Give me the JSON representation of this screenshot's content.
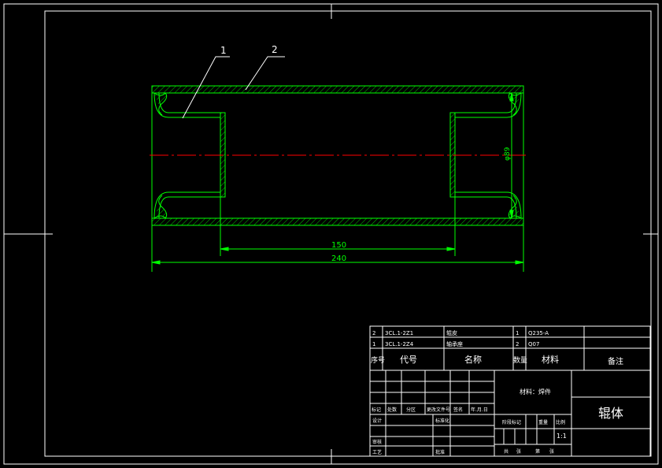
{
  "callouts": [
    "1",
    "2"
  ],
  "dimensions": {
    "inner": "150",
    "overall": "240",
    "diameter": "φ89"
  },
  "bom": {
    "rows": [
      {
        "no": "2",
        "code": "3CL.1-2Z1",
        "name": "辊皮",
        "qty": "1",
        "material": "Q235-A"
      },
      {
        "no": "1",
        "code": "3CL.1-2Z4",
        "name": "轴承座",
        "qty": "2",
        "material": "Q07"
      }
    ],
    "header": {
      "no": "序号",
      "code": "代号",
      "name": "名称",
      "qty": "数量",
      "material": "材料",
      "remark": "备注"
    }
  },
  "titleblock": {
    "material_note": "材料：焊件",
    "part_name": "辊体",
    "scale": "1:1",
    "grid_labels": {
      "mark": "标记",
      "count": "处数",
      "zone": "分区",
      "docno": "更改文件号",
      "sign": "签名",
      "date": "年.月.日",
      "design": "设计",
      "standard": "标准化",
      "review": "审核",
      "process": "工艺",
      "approve": "批准"
    },
    "right_labels": {
      "stage": "阶段标记",
      "weight": "重量",
      "ratio": "比例"
    },
    "sheet": {
      "total": "共",
      "sheet": "张",
      "no": "第",
      "of": "张"
    }
  },
  "colors": {
    "frame": "#ffffff",
    "part": "#00ff00",
    "centerline": "#ff0000"
  }
}
